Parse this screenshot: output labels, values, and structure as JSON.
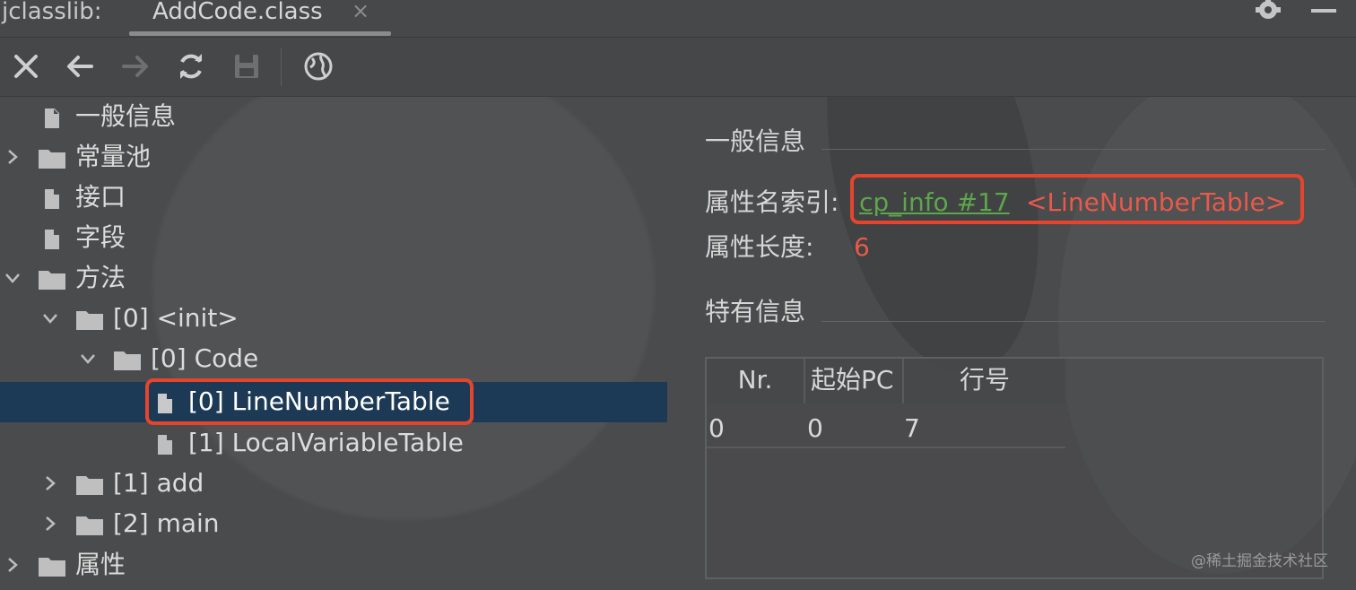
{
  "window": {
    "app_name": "jclasslib:",
    "tab_title": "AddCode.class",
    "tab_close": "×",
    "settings_icon": "gear-icon",
    "minimize_icon": "minimize-icon"
  },
  "toolbar": {
    "buttons": [
      "close-icon",
      "back-arrow-icon",
      "forward-arrow-icon",
      "refresh-icon",
      "save-icon",
      "globe-icon"
    ]
  },
  "tree": {
    "items": [
      {
        "label": "一般信息",
        "type": "file",
        "expanded": null
      },
      {
        "label": "常量池",
        "type": "folder",
        "expanded": false
      },
      {
        "label": "接口",
        "type": "file",
        "expanded": null
      },
      {
        "label": "字段",
        "type": "file",
        "expanded": null
      },
      {
        "label": "方法",
        "type": "folder",
        "expanded": true
      },
      {
        "label": "[0] <init>",
        "type": "folder",
        "expanded": true
      },
      {
        "label": "[0] Code",
        "type": "folder",
        "expanded": true
      },
      {
        "label": "[0] LineNumberTable",
        "type": "file",
        "selected": true
      },
      {
        "label": "[1] LocalVariableTable",
        "type": "file",
        "expanded": null
      },
      {
        "label": "[1] add",
        "type": "folder",
        "expanded": false
      },
      {
        "label": "[2] main",
        "type": "folder",
        "expanded": false
      },
      {
        "label": "属性",
        "type": "folder",
        "expanded": false
      }
    ]
  },
  "detail": {
    "general_title": "一般信息",
    "attr_name_index_label": "属性名索引:",
    "attr_name_index_link": "cp_info #17",
    "attr_name_index_value": "<LineNumberTable>",
    "attr_length_label": "属性长度:",
    "attr_length_value": "6",
    "specific_title": "特有信息",
    "table": {
      "columns": [
        "Nr.",
        "起始PC",
        "行号"
      ],
      "rows": [
        [
          "0",
          "0",
          "7"
        ]
      ]
    }
  },
  "colors": {
    "accent_red": "#e5452d",
    "link_green": "#5ea64c",
    "selection_blue": "#1c3a55"
  },
  "watermark": "@稀土掘金技术社区"
}
